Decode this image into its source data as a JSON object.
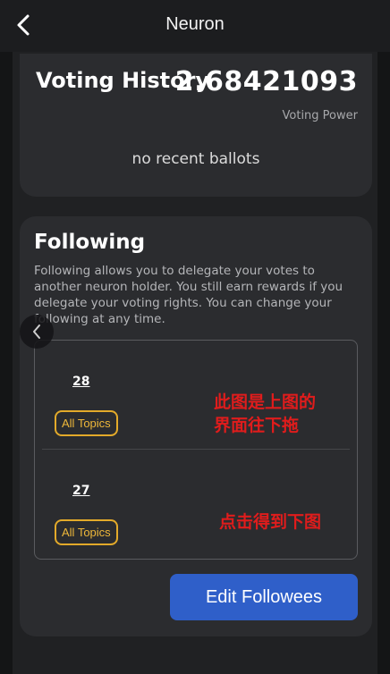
{
  "header": {
    "title": "Neuron"
  },
  "voting_history": {
    "title": "Voting History",
    "voting_power_value": "2.68421093",
    "voting_power_label": "Voting Power",
    "empty_text": "no recent ballots"
  },
  "following": {
    "title": "Following",
    "description": "Following allows you to delegate your votes to another neuron holder. You still earn rewards if you delegate your voting rights. You can change your following at any time.",
    "followees": [
      {
        "id": "28",
        "topic": "All Topics",
        "annotation": "此图是上图的\n界面往下拖"
      },
      {
        "id": "27",
        "topic": "All Topics",
        "annotation": "点击得到下图"
      }
    ],
    "edit_button_label": "Edit Followees"
  },
  "colors": {
    "accent_blue": "#2f5fc9",
    "topic_badge": "#e3aa2a",
    "annotation_red": "#e01c1c",
    "card_bg": "#2b2c2f"
  },
  "icons": {
    "back": "chevron-left-icon",
    "carousel": "chevron-left-icon"
  }
}
